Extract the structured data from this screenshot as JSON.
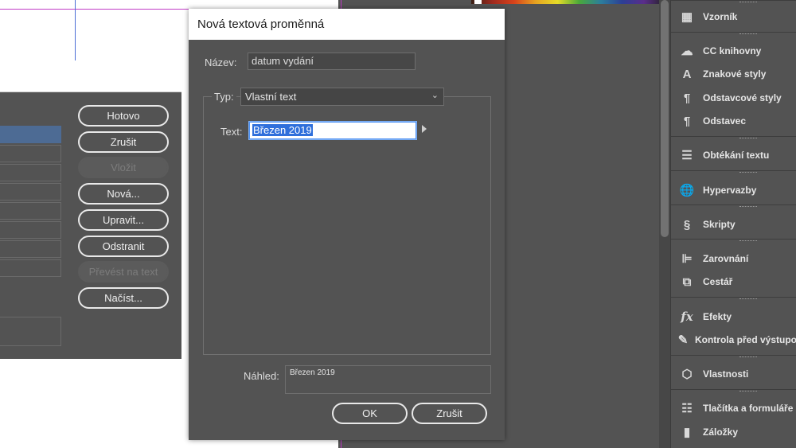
{
  "dialog": {
    "title": "Nová textová proměnná",
    "name_label": "Název:",
    "name_value": "datum vydání",
    "type_label": "Typ:",
    "type_value": "Vlastní text",
    "text_label": "Text:",
    "text_value": "Březen 2019",
    "preview_label": "Náhled:",
    "preview_value": "Březen 2019",
    "ok_label": "OK",
    "cancel_label": "Zrušit"
  },
  "bg_dialog": {
    "buttons": [
      {
        "label": "Hotovo",
        "enabled": true
      },
      {
        "label": "Zrušit",
        "enabled": true
      },
      {
        "label": "Vložit",
        "enabled": false
      },
      {
        "label": "Nová...",
        "enabled": true
      },
      {
        "label": "Upravit...",
        "enabled": true
      },
      {
        "label": "Odstranit",
        "enabled": true
      },
      {
        "label": "Převést na text",
        "enabled": false
      },
      {
        "label": "Načíst...",
        "enabled": true
      }
    ]
  },
  "panel": {
    "items": [
      {
        "label": "Vzorník",
        "icon": "swatches-icon"
      },
      {
        "label": "CC knihovny",
        "icon": "cc-libraries-icon"
      },
      {
        "label": "Znakové styly",
        "icon": "character-styles-icon"
      },
      {
        "label": "Odstavcové styly",
        "icon": "paragraph-styles-icon"
      },
      {
        "label": "Odstavec",
        "icon": "pilcrow-icon"
      },
      {
        "label": "Obtékání textu",
        "icon": "text-wrap-icon"
      },
      {
        "label": "Hypervazby",
        "icon": "hyperlinks-icon"
      },
      {
        "label": "Skripty",
        "icon": "scripts-icon"
      },
      {
        "label": "Zarovnání",
        "icon": "align-icon"
      },
      {
        "label": "Cestář",
        "icon": "pathfinder-icon"
      },
      {
        "label": "Efekty",
        "icon": "fx-icon"
      },
      {
        "label": "Kontrola před výstupo",
        "icon": "preflight-icon"
      },
      {
        "label": "Vlastnosti",
        "icon": "properties-icon"
      },
      {
        "label": "Tlačítka a formuláře",
        "icon": "buttons-forms-icon"
      },
      {
        "label": "Záložky",
        "icon": "bookmark-icon"
      }
    ]
  }
}
